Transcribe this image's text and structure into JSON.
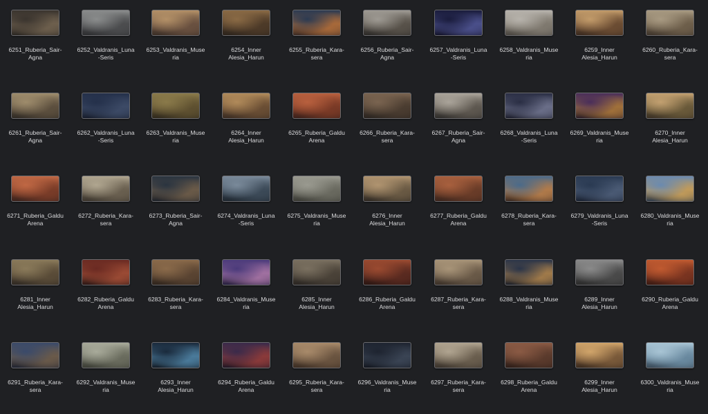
{
  "files": [
    {
      "l1": "6251_Ruberia_Sair-",
      "l2": "Agna",
      "c": [
        "#3a342e",
        "#6d5f4d",
        "#2a2622"
      ]
    },
    {
      "l1": "6252_Valdranis_Luna",
      "l2": "-Seris",
      "c": [
        "#8a8c8c",
        "#4c4d4f",
        "#2d2e30"
      ]
    },
    {
      "l1": "6253_Valdranis_Muse",
      "l2": "ria",
      "c": [
        "#b39067",
        "#6a5140",
        "#3a2e26"
      ]
    },
    {
      "l1": "6254_Inner",
      "l2": "Alesia_Harun",
      "c": [
        "#8a6a45",
        "#4d3a28",
        "#2c241c"
      ]
    },
    {
      "l1": "6255_Ruberia_Kara-",
      "l2": "sera",
      "c": [
        "#2b3a52",
        "#a7693a",
        "#3a2a24"
      ]
    },
    {
      "l1": "6256_Ruberia_Sair-",
      "l2": "Agna",
      "c": [
        "#9e9a93",
        "#58524a",
        "#2c2a28"
      ]
    },
    {
      "l1": "6257_Valdranis_Luna",
      "l2": "-Seris",
      "c": [
        "#1a1c3c",
        "#4a4f8a",
        "#14142a"
      ]
    },
    {
      "l1": "6258_Valdranis_Muse",
      "l2": "ria",
      "c": [
        "#b7b3ac",
        "#807a70",
        "#4a4640"
      ]
    },
    {
      "l1": "6259_Inner",
      "l2": "Alesia_Harun",
      "c": [
        "#c29b6a",
        "#6c4d33",
        "#3a2a1f"
      ]
    },
    {
      "l1": "6260_Ruberia_Kara-",
      "l2": "sera",
      "c": [
        "#a89a82",
        "#6e5f4b",
        "#3e352c"
      ]
    },
    {
      "l1": "6261_Ruberia_Sair-",
      "l2": "Agna",
      "c": [
        "#9e8c6c",
        "#5c4f3e",
        "#2f2a24"
      ]
    },
    {
      "l1": "6262_Valdranis_Luna",
      "l2": "-Seris",
      "c": [
        "#24304a",
        "#3c4a66",
        "#161c2a"
      ]
    },
    {
      "l1": "6263_Valdranis_Muse",
      "l2": "ria",
      "c": [
        "#8a7a4a",
        "#5e5030",
        "#2e281c"
      ]
    },
    {
      "l1": "6264_Inner",
      "l2": "Alesia_Harun",
      "c": [
        "#b08a5a",
        "#6a4e34",
        "#3a2c22"
      ]
    },
    {
      "l1": "6265_Ruberia_Galdu",
      "l2": "Arena",
      "c": [
        "#b8603e",
        "#7a3a26",
        "#3a201a"
      ]
    },
    {
      "l1": "6266_Ruberia_Kara-",
      "l2": "sera",
      "c": [
        "#7a6450",
        "#4a3c30",
        "#2a2420"
      ]
    },
    {
      "l1": "6267_Ruberia_Sair-",
      "l2": "Agna",
      "c": [
        "#aaa49a",
        "#5e5850",
        "#2e2c2a"
      ]
    },
    {
      "l1": "6268_Valdranis_Luna",
      "l2": "-Seris",
      "c": [
        "#2a2e44",
        "#6a6e88",
        "#1c1e2c"
      ]
    },
    {
      "l1": "6269_Valdranis_Muse",
      "l2": "ria",
      "c": [
        "#4a2e5a",
        "#a0703a",
        "#2a1c26"
      ]
    },
    {
      "l1": "6270_Inner",
      "l2": "Alesia_Harun",
      "c": [
        "#c2a070",
        "#6a5a3a",
        "#3a3024"
      ]
    },
    {
      "l1": "6271_Ruberia_Galdu",
      "l2": "Arena",
      "c": [
        "#c06844",
        "#7a3c28",
        "#3a221c"
      ]
    },
    {
      "l1": "6272_Ruberia_Kara-",
      "l2": "sera",
      "c": [
        "#b0a690",
        "#6a6050",
        "#3a342c"
      ]
    },
    {
      "l1": "6273_Ruberia_Sair-",
      "l2": "Agna",
      "c": [
        "#2a3440",
        "#6a5a48",
        "#1c2028"
      ]
    },
    {
      "l1": "6274_Valdranis_Luna",
      "l2": "-Seris",
      "c": [
        "#7a8a9a",
        "#3c4a58",
        "#1e262e"
      ]
    },
    {
      "l1": "6275_Valdranis_Muse",
      "l2": "ria",
      "c": [
        "#9a9a90",
        "#6a6a60",
        "#3a3a34"
      ]
    },
    {
      "l1": "6276_Inner",
      "l2": "Alesia_Harun",
      "c": [
        "#b09470",
        "#6a5a44",
        "#2e2822"
      ]
    },
    {
      "l1": "6277_Ruberia_Galdu",
      "l2": "Arena",
      "c": [
        "#a8603e",
        "#6a3c28",
        "#3a241c"
      ]
    },
    {
      "l1": "6278_Ruberia_Kara-",
      "l2": "sera",
      "c": [
        "#4a6a8a",
        "#b07a4a",
        "#3a2a22"
      ]
    },
    {
      "l1": "6279_Valdranis_Luna",
      "l2": "-Seris",
      "c": [
        "#2a3a52",
        "#4a5a74",
        "#182030"
      ]
    },
    {
      "l1": "6280_Valdranis_Muse",
      "l2": "ria",
      "c": [
        "#6a8ab0",
        "#c09a5a",
        "#2e3a4a"
      ]
    },
    {
      "l1": "6281_Inner",
      "l2": "Alesia_Harun",
      "c": [
        "#8a7a5a",
        "#5a4c38",
        "#2e2822"
      ]
    },
    {
      "l1": "6282_Ruberia_Galdu",
      "l2": "Arena",
      "c": [
        "#6a2a22",
        "#9a4a34",
        "#2a1614"
      ]
    },
    {
      "l1": "6283_Ruberia_Kara-",
      "l2": "sera",
      "c": [
        "#8a6a4a",
        "#5a4432",
        "#2e241c"
      ]
    },
    {
      "l1": "6284_Valdranis_Muse",
      "l2": "ria",
      "c": [
        "#4a3a7a",
        "#a070a0",
        "#221c3a"
      ]
    },
    {
      "l1": "6285_Inner",
      "l2": "Alesia_Harun",
      "c": [
        "#7a7060",
        "#4a4238",
        "#2a2622"
      ]
    },
    {
      "l1": "6286_Ruberia_Galdu",
      "l2": "Arena",
      "c": [
        "#9a4a30",
        "#5a2a20",
        "#2a1612"
      ]
    },
    {
      "l1": "6287_Ruberia_Kara-",
      "l2": "sera",
      "c": [
        "#a89478",
        "#6a5a48",
        "#3a3028"
      ]
    },
    {
      "l1": "6288_Valdranis_Muse",
      "l2": "ria",
      "c": [
        "#2a3448",
        "#a07a4a",
        "#1a1e28"
      ]
    },
    {
      "l1": "6289_Inner",
      "l2": "Alesia_Harun",
      "c": [
        "#8a8a8a",
        "#4a4a4a",
        "#2a2a2a"
      ]
    },
    {
      "l1": "6290_Ruberia_Galdu",
      "l2": "Arena",
      "c": [
        "#c05a30",
        "#7a3420",
        "#3a1a12"
      ]
    },
    {
      "l1": "6291_Ruberia_Kara-",
      "l2": "sera",
      "c": [
        "#3a4a6a",
        "#6a5a4a",
        "#1e2230"
      ]
    },
    {
      "l1": "6292_Valdranis_Muse",
      "l2": "ria",
      "c": [
        "#a8aa9a",
        "#6a6c5e",
        "#3a3c34"
      ]
    },
    {
      "l1": "6293_Inner",
      "l2": "Alesia_Harun",
      "c": [
        "#1a2a3c",
        "#4a7a9a",
        "#121a24"
      ]
    },
    {
      "l1": "6294_Ruberia_Galdu",
      "l2": "Arena",
      "c": [
        "#3a2a4a",
        "#8a3a3a",
        "#1e1624"
      ]
    },
    {
      "l1": "6295_Ruberia_Kara-",
      "l2": "sera",
      "c": [
        "#a88a6a",
        "#6a5440",
        "#3a2c22"
      ]
    },
    {
      "l1": "6296_Valdranis_Muse",
      "l2": "ria",
      "c": [
        "#1e2430",
        "#3a4454",
        "#12161e"
      ]
    },
    {
      "l1": "6297_Ruberia_Kara-",
      "l2": "sera",
      "c": [
        "#b0a490",
        "#6a5e4e",
        "#3a332c"
      ]
    },
    {
      "l1": "6298_Ruberia_Galdu",
      "l2": "Arena",
      "c": [
        "#8a5a44",
        "#5a3a2c",
        "#2e1e18"
      ]
    },
    {
      "l1": "6299_Inner",
      "l2": "Alesia_Harun",
      "c": [
        "#d0a46a",
        "#7a5a3a",
        "#3a2a1e"
      ]
    },
    {
      "l1": "6300_Valdranis_Muse",
      "l2": "ria",
      "c": [
        "#a8c4d4",
        "#6a8aa0",
        "#3a4a58"
      ]
    }
  ]
}
